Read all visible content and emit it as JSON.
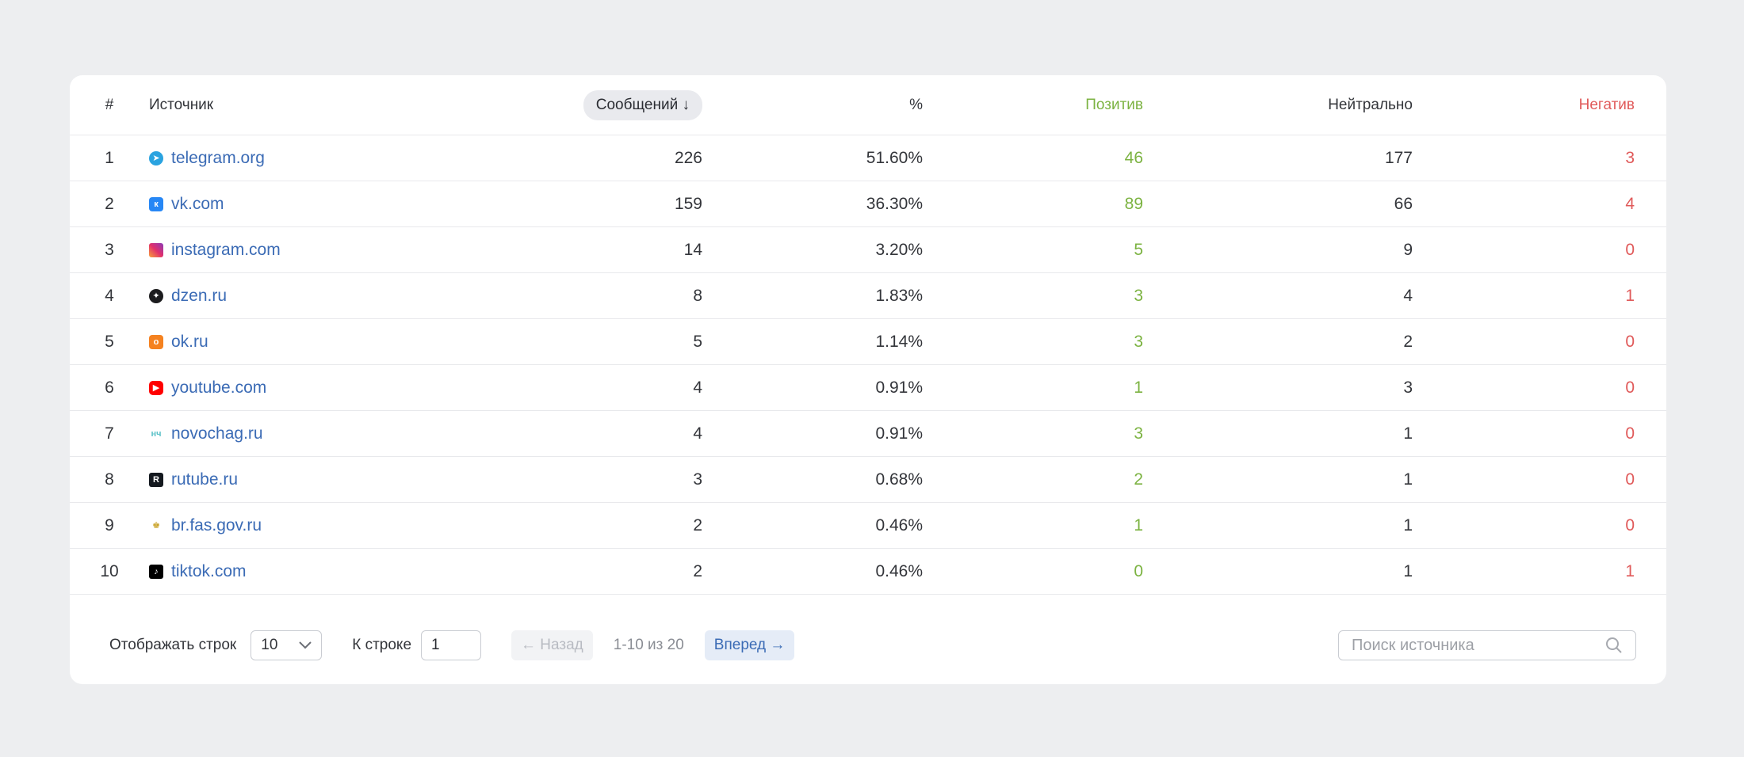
{
  "table": {
    "headers": {
      "num": "#",
      "source": "Источник",
      "messages": "Сообщений",
      "sort_arrow": "↓",
      "percent": "%",
      "positive": "Позитив",
      "neutral": "Нейтрально",
      "negative": "Негатив"
    },
    "rows": [
      {
        "num": "1",
        "source": "telegram.org",
        "icon": "telegram-icon",
        "messages": "226",
        "percent": "51.60%",
        "positive": "46",
        "neutral": "177",
        "negative": "3"
      },
      {
        "num": "2",
        "source": "vk.com",
        "icon": "vk-icon",
        "messages": "159",
        "percent": "36.30%",
        "positive": "89",
        "neutral": "66",
        "negative": "4"
      },
      {
        "num": "3",
        "source": "instagram.com",
        "icon": "instagram-icon",
        "messages": "14",
        "percent": "3.20%",
        "positive": "5",
        "neutral": "9",
        "negative": "0"
      },
      {
        "num": "4",
        "source": "dzen.ru",
        "icon": "dzen-icon",
        "messages": "8",
        "percent": "1.83%",
        "positive": "3",
        "neutral": "4",
        "negative": "1"
      },
      {
        "num": "5",
        "source": "ok.ru",
        "icon": "odnoklassniki-icon",
        "messages": "5",
        "percent": "1.14%",
        "positive": "3",
        "neutral": "2",
        "negative": "0"
      },
      {
        "num": "6",
        "source": "youtube.com",
        "icon": "youtube-icon",
        "messages": "4",
        "percent": "0.91%",
        "positive": "1",
        "neutral": "3",
        "negative": "0"
      },
      {
        "num": "7",
        "source": "novochag.ru",
        "icon": "novochag-icon",
        "messages": "4",
        "percent": "0.91%",
        "positive": "3",
        "neutral": "1",
        "negative": "0"
      },
      {
        "num": "8",
        "source": "rutube.ru",
        "icon": "rutube-icon",
        "messages": "3",
        "percent": "0.68%",
        "positive": "2",
        "neutral": "1",
        "negative": "0"
      },
      {
        "num": "9",
        "source": "br.fas.gov.ru",
        "icon": "emblem-icon",
        "messages": "2",
        "percent": "0.46%",
        "positive": "1",
        "neutral": "1",
        "negative": "0"
      },
      {
        "num": "10",
        "source": "tiktok.com",
        "icon": "tiktok-icon",
        "messages": "2",
        "percent": "0.46%",
        "positive": "0",
        "neutral": "1",
        "negative": "1"
      }
    ]
  },
  "footer": {
    "rows_label": "Отображать строк",
    "rows_value": "10",
    "jump_label": "К строке",
    "jump_value": "1",
    "prev_label": "← Назад",
    "range_label": "1-10 из 20",
    "next_label": "Вперед →",
    "search_placeholder": "Поиск источника"
  },
  "colors": {
    "positive": "#7cb342",
    "negative": "#e05a5a",
    "link": "#3b6bb5"
  }
}
